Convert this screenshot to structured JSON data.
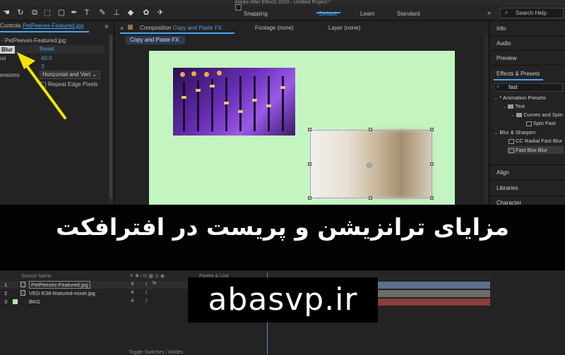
{
  "app": {
    "title": "Adobe After Effects 2020 - Untitled Project *"
  },
  "toolbar": {
    "snapping_label": "Snapping",
    "workspaces": [
      "Default",
      "Learn",
      "Standard"
    ],
    "search_help_placeholder": "Search Help"
  },
  "effect_controls": {
    "tab_prefix": "Controls",
    "tab_source": "PetPeeves-Featured.jpg",
    "layer_path": "- PetPeeves-Featured.jpg",
    "effect_name": "Blur",
    "reset_label": "Reset",
    "radius_label": "us",
    "radius_value": "40.0",
    "iterations_value": "3",
    "dimensions_label": "ensions",
    "dimensions_value": "Horizontal and Vert",
    "repeat_edge_label": "Repeat Edge Pixels"
  },
  "composition": {
    "tab_prefix": "Composition",
    "tab_name": "Copy and Paste FX",
    "footage_tab": "Footage (none)",
    "layer_tab": "Layer (none)",
    "breadcrumb": "Copy and Paste FX"
  },
  "right_panel": {
    "info": "Info",
    "audio": "Audio",
    "preview": "Preview",
    "effects_presets": "Effects & Presets",
    "search_value": "fast",
    "tree": {
      "animation_presets": "* Animation Presets",
      "text": "Text",
      "curves_and_spin": "Curves and Spin",
      "spin_fast": "Spin Fast",
      "blur_sharpen": "Blur & Sharpen",
      "cc_radial": "CC Radial Fast Blur",
      "fast_box_blur": "Fast Box Blur"
    },
    "align": "Align",
    "libraries": "Libraries",
    "character": "Character"
  },
  "timeline": {
    "header_source_name": "Source Name",
    "header_parent": "Parent & Link",
    "layers": [
      {
        "num": "1",
        "name": "PetPeeves-Featured.jpg",
        "color": "#8fa6c7"
      },
      {
        "num": "2",
        "name": "VED-E38-featured-mixer.jpg",
        "color": "#9a9a9a"
      },
      {
        "num": "3",
        "name": "BKG",
        "color": "#b6e6b0"
      }
    ],
    "bottom_label": "Toggle Switches / Modes"
  },
  "overlay": {
    "title": "مزایای ترانزیشن و پریست در افترافکت",
    "website": "abasvp.ir"
  },
  "colors": {
    "accent": "#4aa3f0",
    "comp_background": "#c4f5c0",
    "arrow": "#f5e300"
  }
}
